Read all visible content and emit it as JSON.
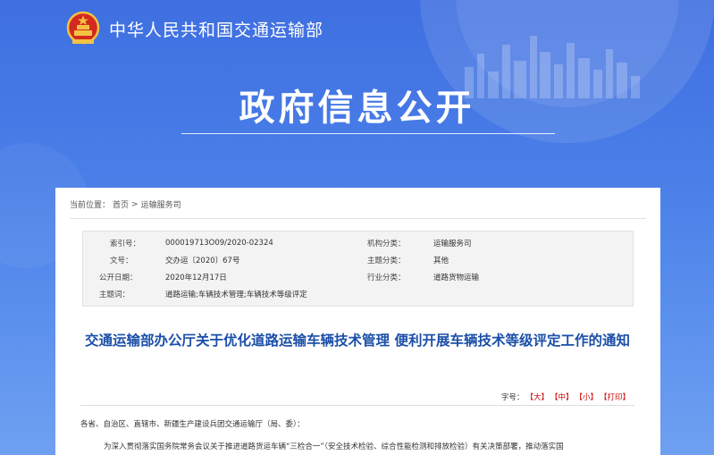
{
  "site": {
    "name": "中华人民共和国交通运输部"
  },
  "banner": {
    "title": "政府信息公开"
  },
  "breadcrumb": {
    "prefix": "当前位置：",
    "items": [
      "首页",
      "运输服务司"
    ],
    "sep": ">"
  },
  "meta": {
    "index_label": "索引号：",
    "index_value": "000019713O09/2020-02324",
    "org_label": "机构分类：",
    "org_value": "运输服务司",
    "docno_label": "文号：",
    "docno_value": "交办运〔2020〕67号",
    "topic_label": "主题分类：",
    "topic_value": "其他",
    "date_label": "公开日期：",
    "date_value": "2020年12月17日",
    "industry_label": "行业分类：",
    "industry_value": "道路货物运输",
    "keywords_label": "主题词：",
    "keywords_value": "道路运输;车辆技术管理;车辆技术等级评定"
  },
  "document": {
    "title": "交通运输部办公厅关于优化道路运输车辆技术管理 便利开展车辆技术等级评定工作的通知",
    "salutation": "各省、自治区、直辖市、新疆生产建设兵团交通运输厅（局、委）：",
    "paragraph": "为深入贯彻落实国务院常务会议关于推进道路货运车辆“三检合一”（安全技术检验、综合性能检测和排放检验）有关决策部署，推动落实国"
  },
  "font_size": {
    "label": "字号：",
    "large": "【大】",
    "medium": "【中】",
    "small": "【小】",
    "print": "【打印】"
  }
}
